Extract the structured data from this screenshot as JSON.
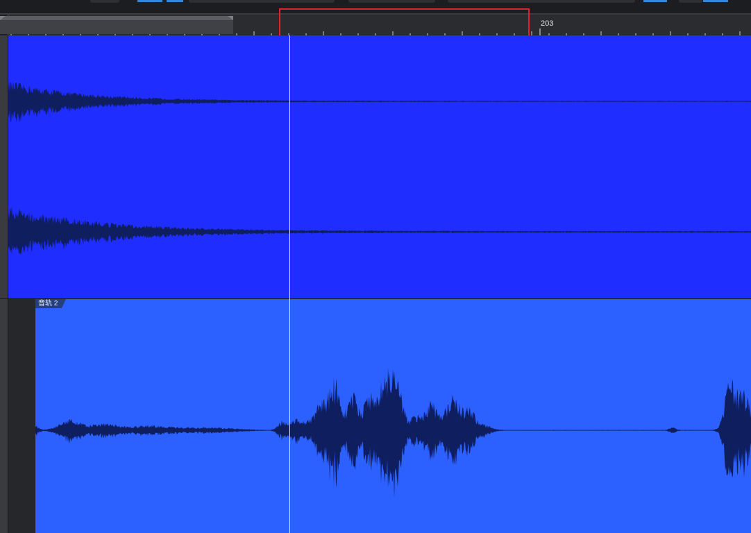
{
  "ruler": {
    "label": "203"
  },
  "tracks": [
    {
      "name": "",
      "color": "#1f2eff",
      "channels": 2
    },
    {
      "name": "音轨 2",
      "color": "#2c61ff",
      "channels": 1
    }
  ],
  "colors": {
    "waveform": "#0f1e5e",
    "playhead": "#e8ecf6",
    "highlight": "#e0222b",
    "loop_region": "#3f4147"
  }
}
